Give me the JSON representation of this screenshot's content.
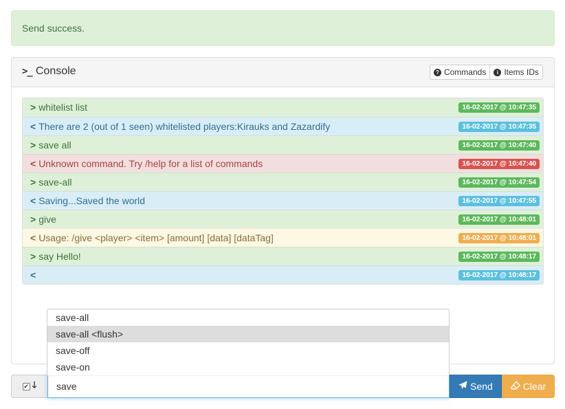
{
  "alert": {
    "text": "Send success."
  },
  "console": {
    "title": "Console",
    "commands_label": "Commands",
    "items_label": "Items IDs"
  },
  "log": [
    {
      "direction": ">",
      "text": "whitelist list",
      "time": "16-02-2017 @ 10:47:35",
      "type": "success"
    },
    {
      "direction": "<",
      "text": "There are 2 (out of 1 seen) whitelisted players:Kirauks and Zazardify",
      "time": "16-02-2017 @ 10:47:35",
      "type": "info"
    },
    {
      "direction": ">",
      "text": "save all",
      "time": "16-02-2017 @ 10:47:40",
      "type": "success"
    },
    {
      "direction": "<",
      "text": "Unknown command. Try /help for a list of commands",
      "time": "16-02-2017 @ 10:47:40",
      "type": "danger"
    },
    {
      "direction": ">",
      "text": "save-all",
      "time": "16-02-2017 @ 10:47:54",
      "type": "success"
    },
    {
      "direction": "<",
      "text": "Saving...Saved the world",
      "time": "16-02-2017 @ 10:47:55",
      "type": "info"
    },
    {
      "direction": ">",
      "text": "give",
      "time": "16-02-2017 @ 10:48:01",
      "type": "success"
    },
    {
      "direction": "<",
      "text": "Usage: /give <player> <item> [amount] [data] [dataTag]",
      "time": "16-02-2017 @ 10:48:01",
      "type": "warning"
    },
    {
      "direction": ">",
      "text": "say Hello!",
      "time": "16-02-2017 @ 10:48:17",
      "type": "success"
    },
    {
      "direction": "<",
      "text": "",
      "time": "16-02-2017 @ 10:48:17",
      "type": "info"
    }
  ],
  "suggestions": {
    "items": [
      "save-all",
      "save-all <flush>",
      "save-off",
      "save-on"
    ],
    "active_index": 1
  },
  "input": {
    "value": "save",
    "checkbox_checked": true,
    "send_label": "Send",
    "clear_label": "Clear"
  },
  "colors": {
    "success": "#5cb85c",
    "info": "#5bc0de",
    "danger": "#d9534f",
    "warning": "#f0ad4e",
    "primary": "#337ab7"
  }
}
